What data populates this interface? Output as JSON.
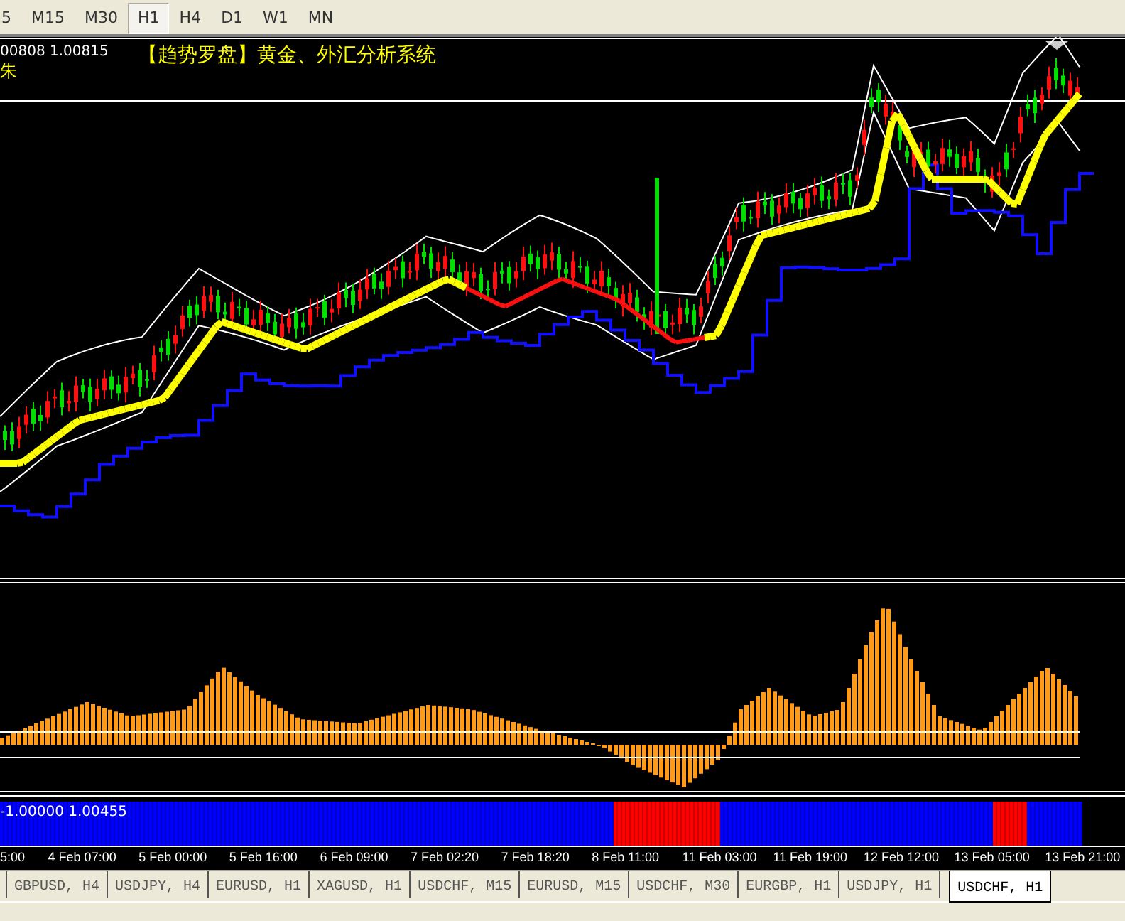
{
  "toolbar": {
    "timeframes": [
      {
        "label": "5",
        "selected": false
      },
      {
        "label": "M15",
        "selected": false
      },
      {
        "label": "M30",
        "selected": false
      },
      {
        "label": "H1",
        "selected": true
      },
      {
        "label": "H4",
        "selected": false
      },
      {
        "label": "D1",
        "selected": false
      },
      {
        "label": "W1",
        "selected": false
      },
      {
        "label": "MN",
        "selected": false
      }
    ]
  },
  "chart": {
    "quote": "00808 1.00815",
    "indicator_label": "朱",
    "title": "【趋势罗盘】黄金、外汇分析系统"
  },
  "band_panel": {
    "label": "-1.00000 1.00455"
  },
  "time_axis": [
    "5:00",
    "4 Feb 07:00",
    "5 Feb 00:00",
    "5 Feb 16:00",
    "6 Feb 09:00",
    "7 Feb 02:20",
    "7 Feb 18:20",
    "8 Feb 11:00",
    "11 Feb 03:00",
    "11 Feb 19:00",
    "12 Feb 12:00",
    "13 Feb 05:00",
    "13 Feb 21:00"
  ],
  "tabs": [
    {
      "label": "GBPUSD, H4",
      "selected": false
    },
    {
      "label": "USDJPY, H4",
      "selected": false
    },
    {
      "label": "EURUSD, H1",
      "selected": false
    },
    {
      "label": "XAGUSD, H1",
      "selected": false
    },
    {
      "label": "USDCHF, M15",
      "selected": false
    },
    {
      "label": "EURUSD, M15",
      "selected": false
    },
    {
      "label": "USDCHF, M30",
      "selected": false
    },
    {
      "label": "EURGBP, H1",
      "selected": false
    },
    {
      "label": "USDJPY, H1",
      "selected": false
    },
    {
      "label": "USDCHF, H1",
      "selected": true
    }
  ]
}
